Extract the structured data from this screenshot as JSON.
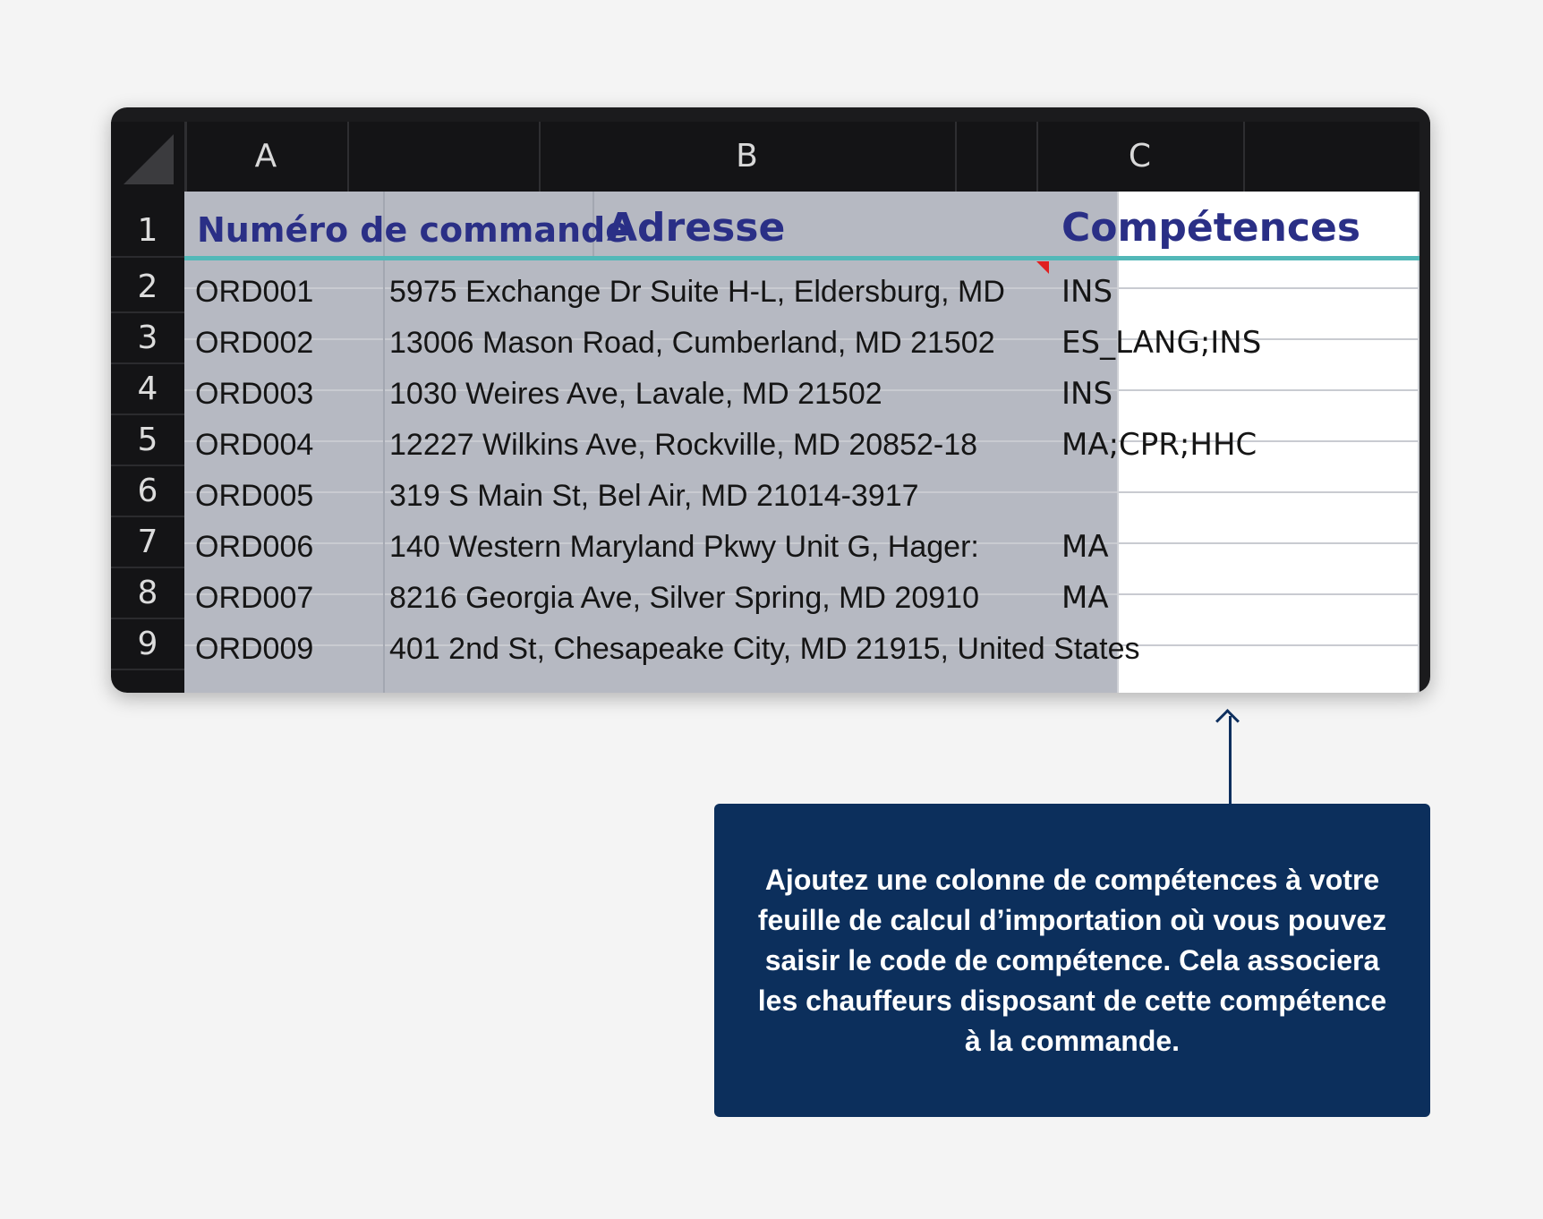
{
  "spreadsheet": {
    "columns": [
      "A",
      "B",
      "C"
    ],
    "row_numbers": [
      "1",
      "2",
      "3",
      "4",
      "5",
      "6",
      "7",
      "8",
      "9"
    ],
    "headers": {
      "order_number": "Numéro de commande",
      "address": "Adresse",
      "skills": "Compétences"
    },
    "rows": [
      {
        "order": "ORD001",
        "address": "5975 Exchange Dr Suite H-L, Eldersburg, MD",
        "skills": "INS"
      },
      {
        "order": "ORD002",
        "address": "13006 Mason Road, Cumberland, MD 21502",
        "skills": "ES_LANG;INS"
      },
      {
        "order": "ORD003",
        "address": "1030 Weires Ave, Lavale, MD 21502",
        "skills": "INS"
      },
      {
        "order": "ORD004",
        "address": "12227 Wilkins Ave, Rockville, MD 20852-18",
        "skills": "MA;CPR;HHC"
      },
      {
        "order": "ORD005",
        "address": "319 S Main St, Bel Air, MD 21014-3917",
        "skills": ""
      },
      {
        "order": "ORD006",
        "address": "140 Western Maryland Pkwy Unit G, Hager:",
        "skills": "MA"
      },
      {
        "order": "ORD007",
        "address": "8216 Georgia Ave, Silver Spring, MD 20910",
        "skills": "MA"
      },
      {
        "order": "ORD009",
        "address": "401 2nd St, Chesapeake City, MD 21915, United States",
        "skills": ""
      }
    ]
  },
  "callout": {
    "text": "Ajoutez une colonne de compétences à votre feuille de calcul d’importation où vous pouvez saisir le code de compétence. Cela associera les chauffeurs disposant de cette compétence à la commande."
  },
  "colors": {
    "header_text": "#2a2f86",
    "teal_underline": "#52b8b8",
    "callout_background": "#0c2f5c"
  }
}
